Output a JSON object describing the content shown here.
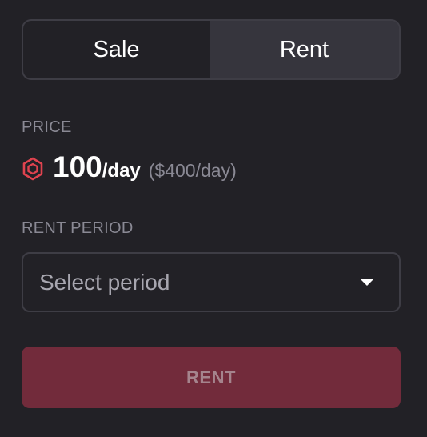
{
  "toggle": {
    "options": [
      "Sale",
      "Rent"
    ],
    "selected": "Rent"
  },
  "price": {
    "label": "PRICE",
    "amount": "100",
    "unit": "/day",
    "usd": "($400/day)",
    "token_icon": "hexagon-token-icon",
    "token_color": "#e0434f"
  },
  "rent_period": {
    "label": "RENT PERIOD",
    "placeholder": "Select period",
    "caret_icon": "caret-down-icon"
  },
  "action": {
    "label": "RENT",
    "disabled": true,
    "color": "#722b3b"
  }
}
